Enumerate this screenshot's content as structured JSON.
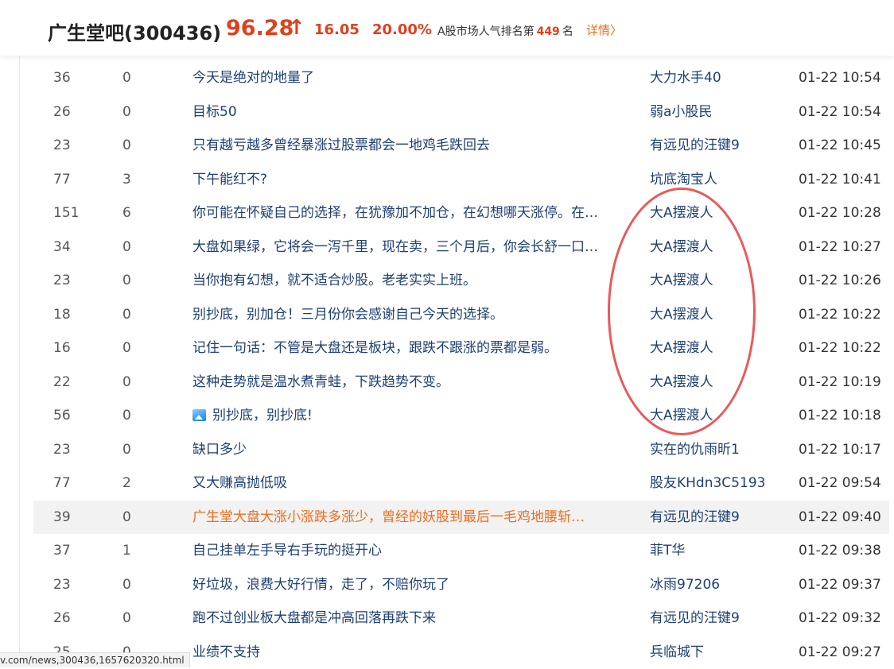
{
  "header": {
    "stock_name": "广生堂吧(300436)",
    "price": "96.28",
    "arrow": "↑",
    "change": "16.05",
    "change_pct": "20.00%",
    "rank_prefix": "A股市场人气排名第",
    "rank_number": "449",
    "rank_suffix": "名",
    "detail_link": "详情〉"
  },
  "colors": {
    "accent_red": "#e0401b",
    "link_blue": "#1d3f74",
    "highlight_orange": "#f26b1d",
    "annotation_red": "#e85a5a"
  },
  "posts": [
    {
      "reads": "36",
      "replies": "0",
      "title": "今天是绝对的地量了",
      "author": "大力水手40",
      "time": "01-22 10:54"
    },
    {
      "reads": "26",
      "replies": "0",
      "title": "目标50",
      "author": "弱a小股民",
      "time": "01-22 10:54"
    },
    {
      "reads": "23",
      "replies": "0",
      "title": "只有越亏越多曾经暴涨过股票都会一地鸡毛跌回去",
      "author": "有远见的汪键9",
      "time": "01-22 10:45"
    },
    {
      "reads": "77",
      "replies": "3",
      "title": "下午能红不?",
      "author": "坑底淘宝人",
      "time": "01-22 10:41"
    },
    {
      "reads": "151",
      "replies": "6",
      "title": "你可能在怀疑自己的选择，在犹豫加不加仓，在幻想哪天涨停。在…",
      "author": "大A摆渡人",
      "time": "01-22 10:28"
    },
    {
      "reads": "34",
      "replies": "0",
      "title": "大盘如果绿，它将会一泻千里，现在卖，三个月后，你会长舒一口…",
      "author": "大A摆渡人",
      "time": "01-22 10:27"
    },
    {
      "reads": "23",
      "replies": "0",
      "title": "当你抱有幻想，就不适合炒股。老老实实上班。",
      "author": "大A摆渡人",
      "time": "01-22 10:26"
    },
    {
      "reads": "18",
      "replies": "0",
      "title": "别抄底，别加仓！三月份你会感谢自己今天的选择。",
      "author": "大A摆渡人",
      "time": "01-22 10:22"
    },
    {
      "reads": "16",
      "replies": "0",
      "title": "记住一句话：不管是大盘还是板块，跟跌不跟涨的票都是弱。",
      "author": "大A摆渡人",
      "time": "01-22 10:22"
    },
    {
      "reads": "22",
      "replies": "0",
      "title": "这种走势就是温水煮青蛙，下跌趋势不变。",
      "author": "大A摆渡人",
      "time": "01-22 10:19"
    },
    {
      "reads": "56",
      "replies": "0",
      "title": "别抄底，别抄底!",
      "author": "大A摆渡人",
      "time": "01-22 10:18",
      "has_image": true
    },
    {
      "reads": "23",
      "replies": "0",
      "title": "缺口多少",
      "author": "实在的仇雨昕1",
      "time": "01-22 10:17"
    },
    {
      "reads": "77",
      "replies": "2",
      "title": "又大赚高抛低吸",
      "author": "股友KHdn3C5193",
      "time": "01-22 09:54"
    },
    {
      "reads": "39",
      "replies": "0",
      "title": "广生堂大盘大涨小涨跌多涨少，曾经的妖股到最后一毛鸡地腰斩…",
      "author": "有远见的汪键9",
      "time": "01-22 09:40",
      "highlighted": true
    },
    {
      "reads": "37",
      "replies": "1",
      "title": "自己挂单左手导右手玩的挺开心",
      "author": "菲T华",
      "time": "01-22 09:38"
    },
    {
      "reads": "23",
      "replies": "0",
      "title": "好垃圾，浪费大好行情，走了，不赔你玩了",
      "author": "冰雨97206",
      "time": "01-22 09:37"
    },
    {
      "reads": "26",
      "replies": "0",
      "title": "跑不过创业板大盘都是冲高回落再跌下来",
      "author": "有远见的汪键9",
      "time": "01-22 09:32"
    },
    {
      "reads": "25",
      "replies": "0",
      "title": "业绩不支持",
      "author": "兵临城下",
      "time": "01-22 09:27"
    }
  ],
  "status_bar": {
    "url": "v.com/news,300436,1657620320.html"
  }
}
